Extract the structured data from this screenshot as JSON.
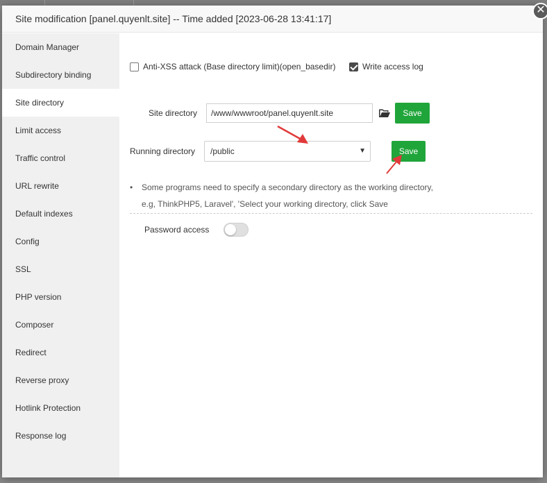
{
  "window": {
    "title": "Site modification [panel.quyenlt.site] -- Time added [2023-06-28 13:41:17]",
    "close_glyph": "✕"
  },
  "sidebar": {
    "items": [
      {
        "label": "Domain Manager",
        "active": false
      },
      {
        "label": "Subdirectory binding",
        "active": false
      },
      {
        "label": "Site directory",
        "active": true
      },
      {
        "label": "Limit access",
        "active": false
      },
      {
        "label": "Traffic control",
        "active": false
      },
      {
        "label": "URL rewrite",
        "active": false
      },
      {
        "label": "Default indexes",
        "active": false
      },
      {
        "label": "Config",
        "active": false
      },
      {
        "label": "SSL",
        "active": false
      },
      {
        "label": "PHP version",
        "active": false
      },
      {
        "label": "Composer",
        "active": false
      },
      {
        "label": "Redirect",
        "active": false
      },
      {
        "label": "Reverse proxy",
        "active": false
      },
      {
        "label": "Hotlink Protection",
        "active": false
      },
      {
        "label": "Response log",
        "active": false
      }
    ]
  },
  "options": {
    "anti_xss": {
      "label": "Anti-XSS attack (Base directory limit)(open_basedir)",
      "checked": false
    },
    "access_log": {
      "label": "Write access log",
      "checked": true
    }
  },
  "site_directory": {
    "label": "Site directory",
    "value": "/www/wwwroot/panel.quyenlt.site",
    "folder_icon": "folder-open-icon",
    "save_label": "Save"
  },
  "running_directory": {
    "label": "Running directory",
    "value": "/public",
    "save_label": "Save"
  },
  "notes": {
    "line1": "Some programs need to specify a secondary directory as the working directory,",
    "line2": "e.g, ThinkPHP5, Laravel', 'Select your working directory, click Save"
  },
  "password_access": {
    "label": "Password access",
    "enabled": false
  },
  "colors": {
    "accent_green": "#20a53a",
    "annotation_red": "#e03a3a",
    "sidebar_bg": "#f0f0f0"
  }
}
